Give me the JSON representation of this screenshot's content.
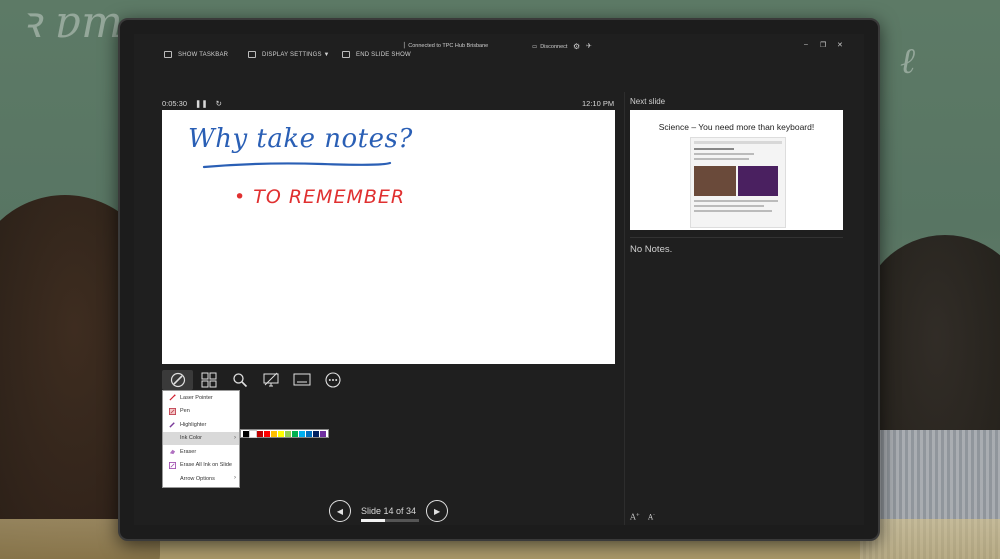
{
  "toolbar": {
    "show_taskbar": "SHOW TASKBAR",
    "display_settings": "DISPLAY SETTINGS ▼",
    "end_slide_show": "END SLIDE SHOW",
    "connection_status": "Connected to TPC Hub Brisbane",
    "disconnect": "Disconnect"
  },
  "presenter": {
    "timer": "0:05:30",
    "clock": "12:10 PM",
    "slide_counter": "Slide 14 of 34",
    "progress_fraction": 0.41
  },
  "current_slide": {
    "ink_title": "Why take notes?",
    "ink_bullet": "• TO REMEMBER"
  },
  "pen_menu": {
    "items": [
      {
        "label": "Laser Pointer",
        "icon": "laser-pointer-icon"
      },
      {
        "label": "Pen",
        "icon": "pen-icon"
      },
      {
        "label": "Highlighter",
        "icon": "highlighter-icon"
      },
      {
        "label": "Ink Color",
        "icon": "",
        "submenu": true
      },
      {
        "label": "Eraser",
        "icon": "eraser-icon"
      },
      {
        "label": "Erase All Ink on Slide",
        "icon": "erase-all-icon"
      },
      {
        "label": "Arrow Options",
        "icon": "",
        "submenu": true
      }
    ],
    "ink_colors": [
      "#000000",
      "#ffffff",
      "#c00000",
      "#ff0000",
      "#ffc000",
      "#ffff00",
      "#92d050",
      "#00b050",
      "#00b0f0",
      "#0070c0",
      "#002060",
      "#7030a0"
    ]
  },
  "next_slide": {
    "label": "Next slide",
    "title": "Science – You need more than keyboard!"
  },
  "notes": {
    "text": "No Notes."
  },
  "colors": {
    "ink_blue": "#2a5fb5",
    "ink_red": "#e03030",
    "presenter_bg": "#1f1f1f"
  }
}
